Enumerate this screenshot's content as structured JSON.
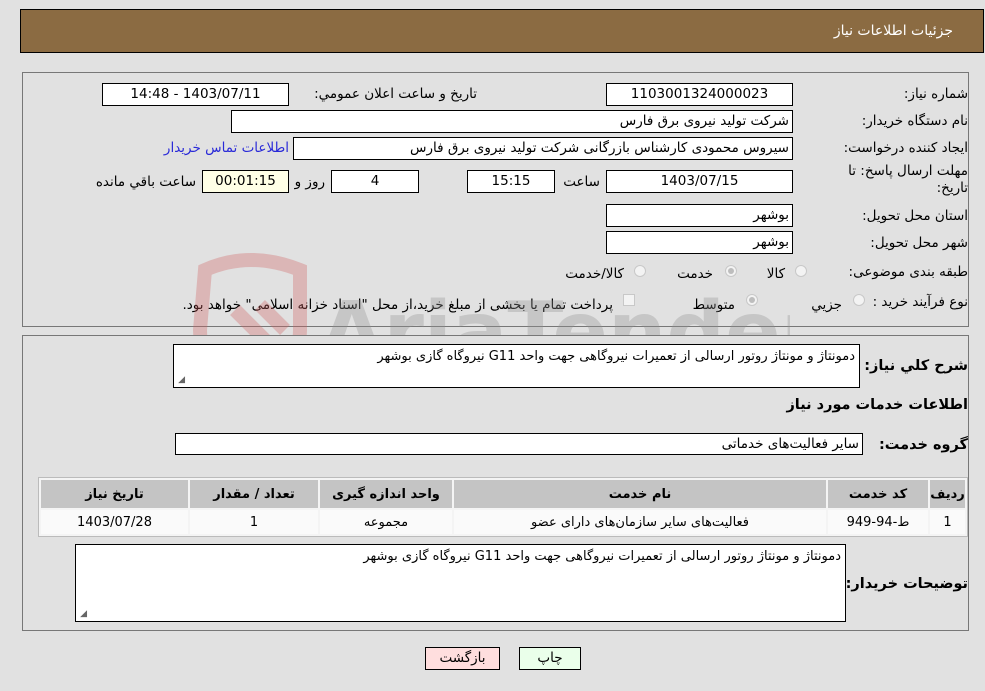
{
  "header": {
    "title": "جزئیات اطلاعات نیاز"
  },
  "need_info": {
    "need_number_label": "شماره نیاز:",
    "need_number": "1103001324000023",
    "announce_label": "تاریخ و ساعت اعلان عمومي:",
    "announce_value": "1403/07/11 - 14:48",
    "buyer_org_label": "نام دستگاه خریدار:",
    "buyer_org": "شرکت تولید نیروی برق فارس",
    "creator_label": "ایجاد کننده درخواست:",
    "creator": "سیروس محمودی کارشناس بازرگانی شرکت تولید نیروی برق فارس",
    "buyer_contact_link": "اطلاعات تماس خریدار",
    "deadline_label_line1": "مهلت ارسال پاسخ: تا",
    "deadline_label_line2": "تاریخ:",
    "deadline_date": "1403/07/15",
    "time_label": "ساعت",
    "deadline_time": "15:15",
    "days_value": "4",
    "days_label": "روز و",
    "remaining_time": "00:01:15",
    "remaining_label": "ساعت باقي مانده",
    "province_label": "استان محل تحویل:",
    "province": "بوشهر",
    "city_label": "شهر محل تحویل:",
    "city": "بوشهر",
    "category_label": "طبقه بندی موضوعی:",
    "category_options": [
      {
        "label": "کالا",
        "checked": false
      },
      {
        "label": "خدمت",
        "checked": true
      },
      {
        "label": "کالا/خدمت",
        "checked": false
      }
    ],
    "purchase_type_label": "نوع فرآیند خرید :",
    "purchase_type_options": [
      {
        "label": "جزيي",
        "checked": false
      },
      {
        "label": "متوسط",
        "checked": true
      }
    ],
    "treasury_note": "پرداخت تمام یا بخشی از مبلغ خرید،از محل \"اسناد خزانه اسلامی\" خواهد بود.",
    "treasury_checked": false
  },
  "details": {
    "summary_label": "شرح کلي نیاز:",
    "summary": "دمونتاژ و مونتاژ روتور ارسالی از تعمیرات نیروگاهی جهت واحد G11 نیروگاه گازی بوشهر",
    "services_heading": "اطلاعات خدمات مورد نیاز",
    "service_group_label": "گروه خدمت:",
    "service_group": "سایر فعالیت‌های خدماتی",
    "table": {
      "columns": [
        "ردیف",
        "کد خدمت",
        "نام خدمت",
        "واحد اندازه گیری",
        "تعداد / مقدار",
        "تاریخ نیاز"
      ],
      "rows": [
        [
          "1",
          "ط-94-949",
          "فعالیت‌های سایر سازمان‌های دارای عضو",
          "مجموعه",
          "1",
          "1403/07/28"
        ]
      ]
    },
    "buyer_notes_label": "توضیحات خریدار:",
    "buyer_notes": "دمونتاژ و مونتاژ روتور ارسالی از تعمیرات نیروگاهی جهت واحد G11 نیروگاه گازی بوشهر"
  },
  "buttons": {
    "print": "چاپ",
    "back": "بازگشت"
  },
  "watermark": {
    "text": "AriaTender.neT"
  },
  "colors": {
    "header_bg": "#8b6b42",
    "print_bg": "#eaffea",
    "back_bg": "#ffdede",
    "link": "#2a2ad8"
  }
}
